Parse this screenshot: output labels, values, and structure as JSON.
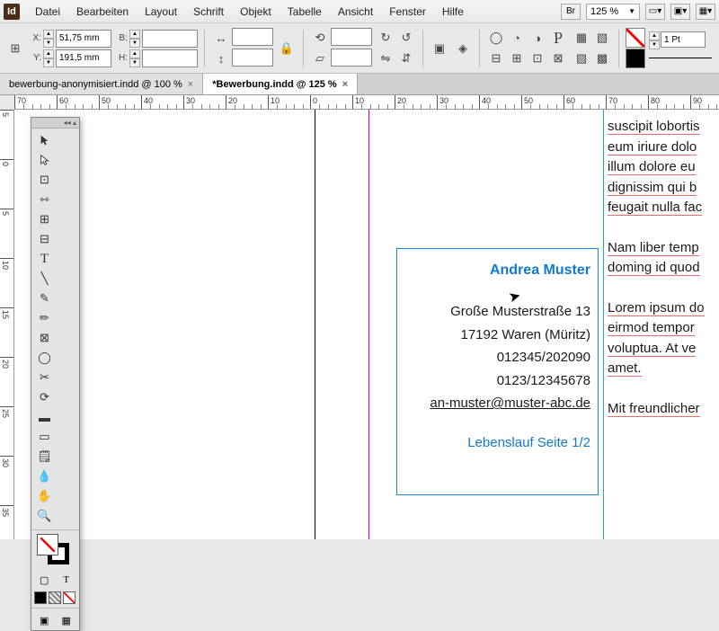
{
  "app": {
    "icon": "Id"
  },
  "menu": [
    "Datei",
    "Bearbeiten",
    "Layout",
    "Schrift",
    "Objekt",
    "Tabelle",
    "Ansicht",
    "Fenster",
    "Hilfe"
  ],
  "zoom_main": "125 %",
  "control": {
    "x": "51,75 mm",
    "y": "191,5 mm",
    "b": "",
    "h": "",
    "stroke_weight": "1 Pt"
  },
  "tabs": [
    {
      "label": "bewerbung-anonymisiert.indd @ 100 %",
      "active": false
    },
    {
      "label": "*Bewerbung.indd @ 125 %",
      "active": true
    }
  ],
  "ruler_h": [
    "70",
    "60",
    "50",
    "40",
    "30",
    "20",
    "10",
    "0",
    "10",
    "20",
    "30",
    "40",
    "50",
    "60",
    "70",
    "80",
    "90"
  ],
  "ruler_v": [
    "5",
    "0",
    "5",
    "10",
    "15",
    "20",
    "25",
    "30",
    "35"
  ],
  "frame": {
    "name": "Andrea Muster",
    "addr1": "Große Musterstraße 13",
    "addr2": "17192 Waren (Müritz)",
    "tel1": "012345/202090",
    "tel2": "0123/12345678",
    "email": "an-muster@muster-abc.de",
    "footer": "Lebenslauf Seite 1/2"
  },
  "overflow": {
    "p1": [
      "suscipit lobortis",
      "eum iriure dolo",
      "illum dolore eu",
      "dignissim qui b",
      "feugait nulla fac"
    ],
    "p2": [
      "Nam liber temp",
      "doming id quod"
    ],
    "p3": [
      "Lorem ipsum do",
      "eirmod tempor",
      "voluptua. At ve",
      "amet."
    ],
    "p4": [
      "Mit freundlicher"
    ]
  },
  "labels": {
    "X": "X:",
    "Y": "Y:",
    "B": "B:",
    "H": "H:",
    "Br": "Br"
  }
}
